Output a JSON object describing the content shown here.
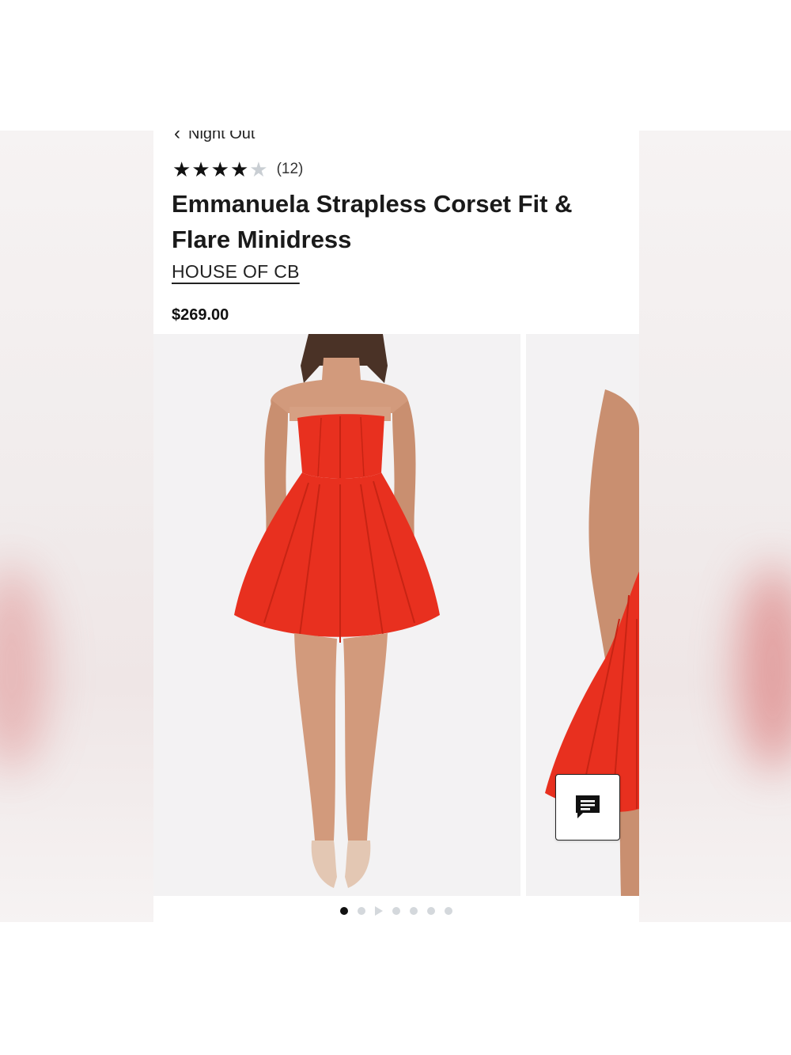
{
  "breadcrumb": {
    "label": "Night Out"
  },
  "rating": {
    "stars_filled": 4,
    "stars_total": 5,
    "review_count": "(12)"
  },
  "product": {
    "title": "Emmanuela Strapless Corset Fit & Flare Minidress",
    "brand": "HOUSE OF CB",
    "price": "$269.00",
    "color": "#e8301f"
  },
  "gallery": {
    "image_count": 7,
    "active_index": 0,
    "video_slot_index": 2
  },
  "icons": {
    "back": "chevron-left-icon",
    "star": "star-icon",
    "chat": "chat-icon",
    "video": "play-icon"
  }
}
